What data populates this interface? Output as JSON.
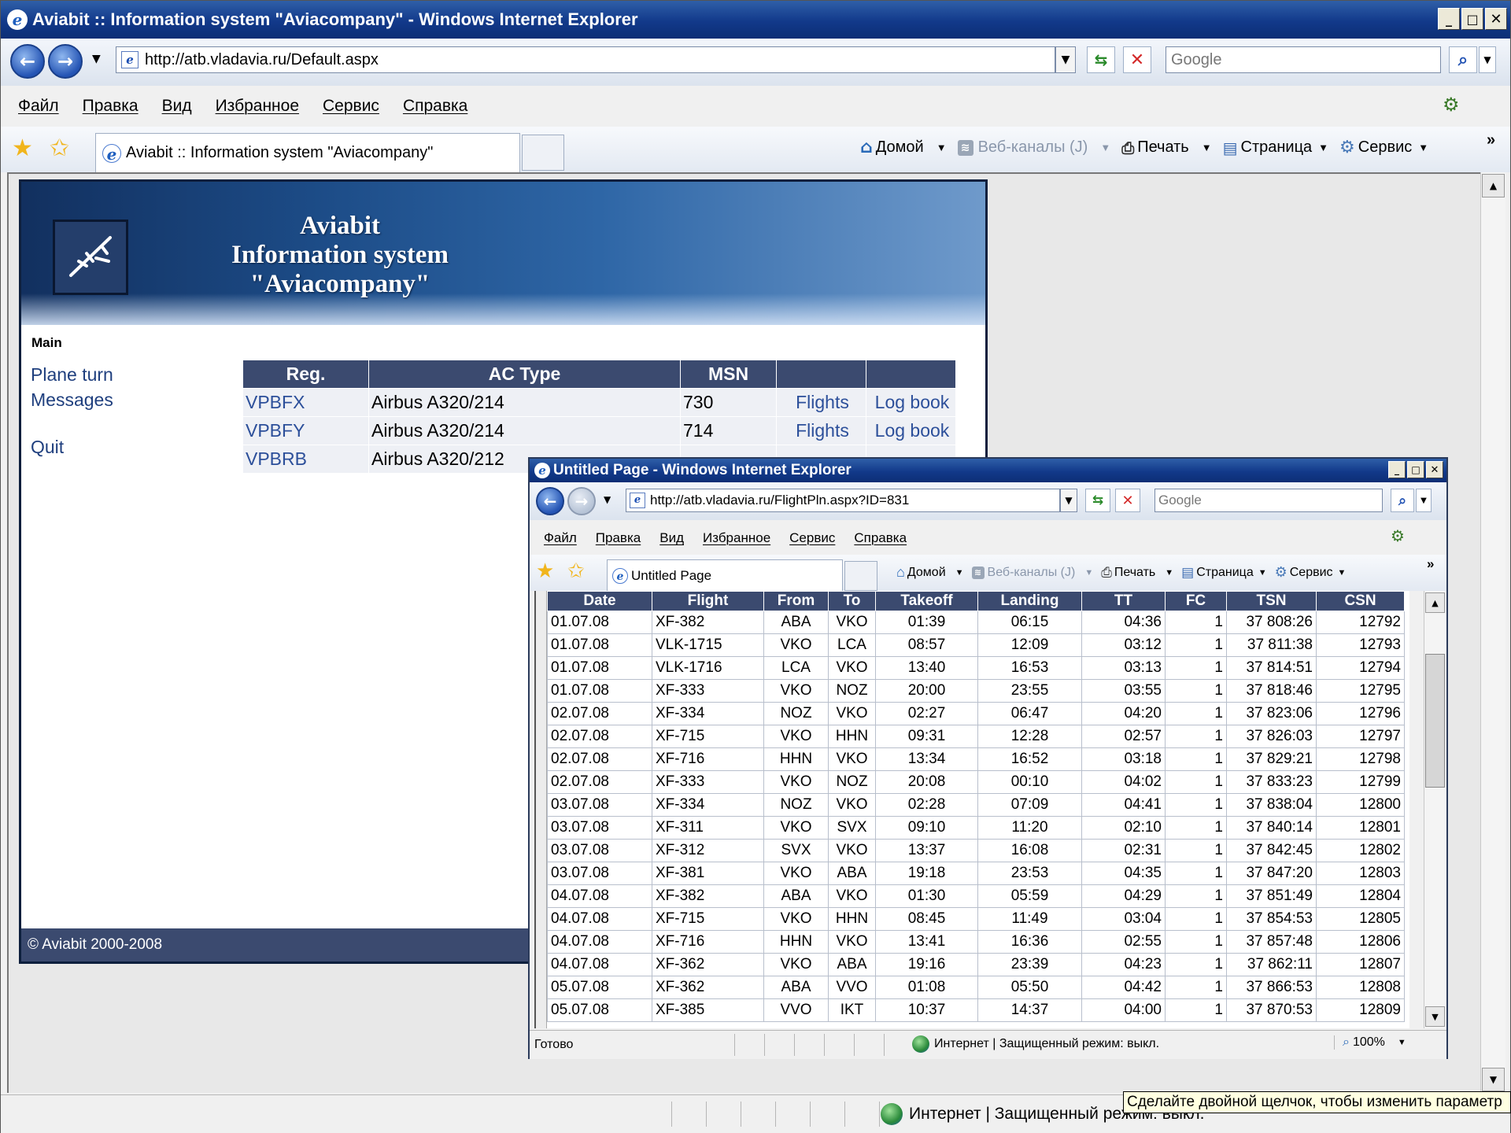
{
  "main_window": {
    "title": "Aviabit :: Information system \"Aviacompany\" - Windows Internet Explorer",
    "address": "http://atb.vladavia.ru/Default.aspx",
    "search_placeholder": "Google",
    "menu": [
      "Файл",
      "Правка",
      "Вид",
      "Избранное",
      "Сервис",
      "Справка"
    ],
    "tab_title": "Aviabit :: Information system \"Aviacompany\"",
    "commands": {
      "home": "Домой",
      "feeds": "Веб-каналы (J)",
      "print": "Печать",
      "page": "Страница",
      "tools": "Сервис"
    },
    "status_zone": "Интернет | Защищенный режим: выкл.",
    "zoom": "100%"
  },
  "site": {
    "banner_line1": "Aviabit",
    "banner_line2": "Information system",
    "banner_line3": "\"Aviacompany\"",
    "main_label": "Main",
    "nav": [
      "Plane turn",
      "Messages",
      "Quit"
    ],
    "table_headers": [
      "Reg.",
      "AC Type",
      "MSN",
      "",
      ""
    ],
    "rows": [
      {
        "reg": "VPBFX",
        "type": "Airbus A320/214",
        "msn": "730",
        "flights": "Flights",
        "logbook": "Log book"
      },
      {
        "reg": "VPBFY",
        "type": "Airbus A320/214",
        "msn": "714",
        "flights": "Flights",
        "logbook": "Log book"
      },
      {
        "reg": "VPBRB",
        "type": "Airbus A320/212",
        "msn": "",
        "flights": "",
        "logbook": ""
      }
    ],
    "footer": "© Aviabit 2000-2008"
  },
  "popup_window": {
    "title": "Untitled Page - Windows Internet Explorer",
    "address": "http://atb.vladavia.ru/FlightPln.aspx?ID=831",
    "search_placeholder": "Google",
    "menu": [
      "Файл",
      "Правка",
      "Вид",
      "Избранное",
      "Сервис",
      "Справка"
    ],
    "tab_title": "Untitled Page",
    "commands": {
      "home": "Домой",
      "feeds": "Веб-каналы (J)",
      "print": "Печать",
      "page": "Страница",
      "tools": "Сервис"
    },
    "status_left": "Готово",
    "status_zone": "Интернет | Защищенный режим: выкл.",
    "zoom": "100%"
  },
  "flights": {
    "headers": [
      "Date",
      "Flight",
      "From",
      "To",
      "Takeoff",
      "Landing",
      "TT",
      "FC",
      "TSN",
      "CSN"
    ],
    "rows": [
      [
        "01.07.08",
        "XF-382",
        "ABA",
        "VKO",
        "01:39",
        "06:15",
        "04:36",
        "1",
        "37 808:26",
        "12792"
      ],
      [
        "01.07.08",
        "VLK-1715",
        "VKO",
        "LCA",
        "08:57",
        "12:09",
        "03:12",
        "1",
        "37 811:38",
        "12793"
      ],
      [
        "01.07.08",
        "VLK-1716",
        "LCA",
        "VKO",
        "13:40",
        "16:53",
        "03:13",
        "1",
        "37 814:51",
        "12794"
      ],
      [
        "01.07.08",
        "XF-333",
        "VKO",
        "NOZ",
        "20:00",
        "23:55",
        "03:55",
        "1",
        "37 818:46",
        "12795"
      ],
      [
        "02.07.08",
        "XF-334",
        "NOZ",
        "VKO",
        "02:27",
        "06:47",
        "04:20",
        "1",
        "37 823:06",
        "12796"
      ],
      [
        "02.07.08",
        "XF-715",
        "VKO",
        "HHN",
        "09:31",
        "12:28",
        "02:57",
        "1",
        "37 826:03",
        "12797"
      ],
      [
        "02.07.08",
        "XF-716",
        "HHN",
        "VKO",
        "13:34",
        "16:52",
        "03:18",
        "1",
        "37 829:21",
        "12798"
      ],
      [
        "02.07.08",
        "XF-333",
        "VKO",
        "NOZ",
        "20:08",
        "00:10",
        "04:02",
        "1",
        "37 833:23",
        "12799"
      ],
      [
        "03.07.08",
        "XF-334",
        "NOZ",
        "VKO",
        "02:28",
        "07:09",
        "04:41",
        "1",
        "37 838:04",
        "12800"
      ],
      [
        "03.07.08",
        "XF-311",
        "VKO",
        "SVX",
        "09:10",
        "11:20",
        "02:10",
        "1",
        "37 840:14",
        "12801"
      ],
      [
        "03.07.08",
        "XF-312",
        "SVX",
        "VKO",
        "13:37",
        "16:08",
        "02:31",
        "1",
        "37 842:45",
        "12802"
      ],
      [
        "03.07.08",
        "XF-381",
        "VKO",
        "ABA",
        "19:18",
        "23:53",
        "04:35",
        "1",
        "37 847:20",
        "12803"
      ],
      [
        "04.07.08",
        "XF-382",
        "ABA",
        "VKO",
        "01:30",
        "05:59",
        "04:29",
        "1",
        "37 851:49",
        "12804"
      ],
      [
        "04.07.08",
        "XF-715",
        "VKO",
        "HHN",
        "08:45",
        "11:49",
        "03:04",
        "1",
        "37 854:53",
        "12805"
      ],
      [
        "04.07.08",
        "XF-716",
        "HHN",
        "VKO",
        "13:41",
        "16:36",
        "02:55",
        "1",
        "37 857:48",
        "12806"
      ],
      [
        "04.07.08",
        "XF-362",
        "VKO",
        "ABA",
        "19:16",
        "23:39",
        "04:23",
        "1",
        "37 862:11",
        "12807"
      ],
      [
        "05.07.08",
        "XF-362",
        "ABA",
        "VVO",
        "01:08",
        "05:50",
        "04:42",
        "1",
        "37 866:53",
        "12808"
      ],
      [
        "05.07.08",
        "XF-385",
        "VVO",
        "IKT",
        "10:37",
        "14:37",
        "04:00",
        "1",
        "37 870:53",
        "12809"
      ]
    ]
  },
  "tooltip": "Сделайте двойной щелчок, чтобы изменить параметр"
}
